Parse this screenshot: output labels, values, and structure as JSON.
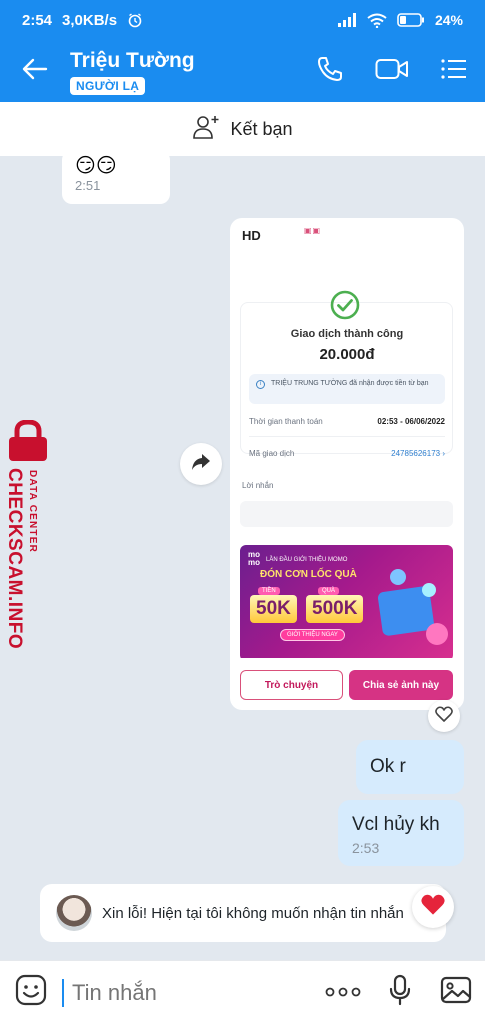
{
  "status_bar": {
    "time": "2:54",
    "speed": "3,0KB/s",
    "battery": "24"
  },
  "header": {
    "contact_name": "Triệu Tường",
    "stranger_tag": "NGƯỜI LẠ",
    "icons": [
      "back-arrow-icon",
      "phone-icon",
      "video-call-icon",
      "menu-list-icon"
    ]
  },
  "add_friend": {
    "label": "Kết bạn"
  },
  "messages": {
    "incoming_emoji": {
      "text": "😏😏",
      "time": "2:51"
    },
    "payment_card": {
      "quality_label": "HD",
      "success_title": "Giao dịch thành công",
      "amount": "20.000đ",
      "note": "TRIỆU TRUNG TƯỜNG đã nhận được tiền từ bạn",
      "pay_time_label": "Thời gian thanh toán",
      "pay_time_value": "02:53 - 06/06/2022",
      "txn_label": "Mã giao dịch",
      "txn_value": "24785626173",
      "message_label": "Lời nhắn",
      "promo": {
        "brand": "mo\nmo",
        "subtitle": "LẦN ĐẦU GIỚI THIỆU MOMO",
        "headline": "ĐÓN CƠN LỐC QUÀ",
        "label_1": "TIỀN",
        "label_2": "QUÀ",
        "amount_1": "50K",
        "amount_2": "500K",
        "cta": "GIỚI THIỆU NGAY"
      },
      "button_help": "Trò chuyện",
      "button_share": "Chia sẻ ảnh này"
    },
    "outgoing_1": {
      "text": "Ok r"
    },
    "outgoing_2": {
      "text": "Vcl hủy kh",
      "time": "2:53"
    },
    "system_notice": {
      "text": "Xin lỗi! Hiện tại tôi không muốn nhận tin nhắn"
    }
  },
  "watermark": {
    "line_1": "DATA CENTER",
    "line_2": "CHECKSCAM.INFO"
  },
  "input_bar": {
    "placeholder": "Tin nhắn",
    "icons": [
      "sticker-icon",
      "more-dots-icon",
      "microphone-icon",
      "image-icon"
    ]
  },
  "colors": {
    "accent": "#1a8cf0",
    "momo_pink": "#d63384",
    "out_bubble": "#d6ebfd",
    "watermark": "#c8102e"
  }
}
